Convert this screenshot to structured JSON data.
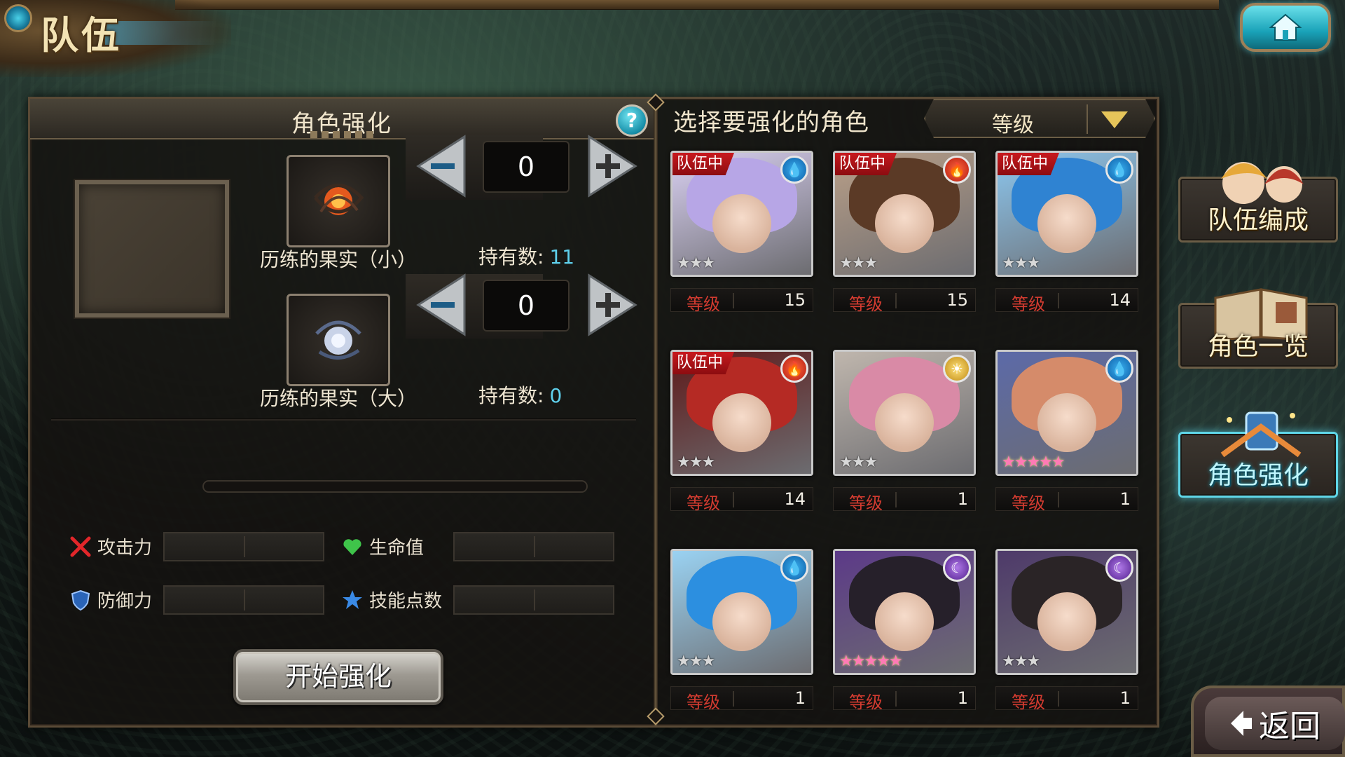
{
  "header": {
    "title": "队伍"
  },
  "enhance_panel": {
    "title": "角色强化",
    "help_label": "?",
    "items": [
      {
        "name": "历练的果实（小）",
        "qty": "0",
        "owned_label": "持有数:",
        "owned_value": "11",
        "minus": "−",
        "plus": "+"
      },
      {
        "name": "历练的果实（大）",
        "qty": "0",
        "owned_label": "持有数:",
        "owned_value": "0",
        "minus": "−",
        "plus": "+"
      }
    ],
    "stats": [
      {
        "label": "攻击力",
        "icon": "swords-icon"
      },
      {
        "label": "生命值",
        "icon": "heart-icon"
      },
      {
        "label": "防御力",
        "icon": "shield-icon"
      },
      {
        "label": "技能点数",
        "icon": "star-icon"
      }
    ],
    "start_button": "开始强化"
  },
  "roster": {
    "title": "选择要强化的角色",
    "sort_label": "等级",
    "level_label": "等级",
    "in_team_label": "队伍中",
    "cards": [
      {
        "in_team": true,
        "element": "water",
        "stars": "★★★",
        "level": "15",
        "colors": [
          "#b7a6e6",
          "#d9d0f2"
        ]
      },
      {
        "in_team": true,
        "element": "fire",
        "stars": "★★★",
        "level": "15",
        "colors": [
          "#5b3a26",
          "#b99f88"
        ]
      },
      {
        "in_team": true,
        "element": "water",
        "stars": "★★★",
        "level": "14",
        "colors": [
          "#2f83d2",
          "#8cc7ef"
        ]
      },
      {
        "in_team": true,
        "element": "fire",
        "stars": "★★★",
        "level": "14",
        "colors": [
          "#b52a24",
          "#5e1a1a"
        ]
      },
      {
        "in_team": false,
        "element": "light",
        "stars": "★★★",
        "level": "1",
        "colors": [
          "#d98aa6",
          "#bfb6ad"
        ]
      },
      {
        "in_team": false,
        "element": "water",
        "stars": "★★★★★",
        "level": "1",
        "colors": [
          "#d58b6a",
          "#5c6aa8"
        ]
      },
      {
        "in_team": false,
        "element": "water",
        "stars": "★★★",
        "level": "1",
        "colors": [
          "#2c8fe0",
          "#9ad2f2"
        ]
      },
      {
        "in_team": false,
        "element": "dark",
        "stars": "★★★★★",
        "level": "1",
        "colors": [
          "#26202a",
          "#5c3a88"
        ]
      },
      {
        "in_team": false,
        "element": "dark",
        "stars": "★★★",
        "level": "1",
        "colors": [
          "#2a2426",
          "#4e3a6a"
        ]
      }
    ]
  },
  "side_nav": [
    {
      "label": "队伍编成",
      "active": false
    },
    {
      "label": "角色一览",
      "active": false
    },
    {
      "label": "角色强化",
      "active": true
    }
  ],
  "back_button": "返回",
  "element_symbols": {
    "water": "💧",
    "fire": "🔥",
    "light": "☀",
    "dark": "☾"
  }
}
